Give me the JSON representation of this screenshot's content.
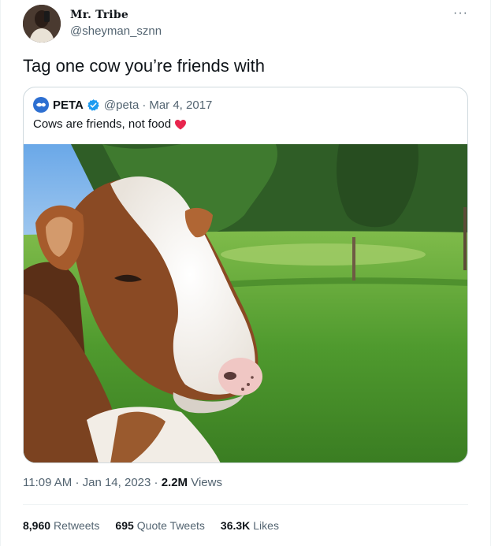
{
  "author": {
    "display_name": "Mr. Tribe",
    "handle": "@sheyman_sznn"
  },
  "more_icon": "more-horizontal-icon",
  "tweet": {
    "text": "Tag one cow you’re friends with"
  },
  "quoted": {
    "name": "PETA",
    "handle": "@peta",
    "separator": "·",
    "date": "Mar 4, 2017",
    "text": "Cows are friends, not food",
    "emoji": "heart-icon",
    "heart_color": "#e8254d",
    "verified_color": "#1d9bf0"
  },
  "meta": {
    "time": "11:09 AM",
    "sep1": "·",
    "date": "Jan 14, 2023",
    "sep2": "·",
    "views_count": "2.2M",
    "views_label": "Views"
  },
  "stats": {
    "retweets_count": "8,960",
    "retweets_label": "Retweets",
    "quotes_count": "695",
    "quotes_label": "Quote Tweets",
    "likes_count": "36.3K",
    "likes_label": "Likes"
  }
}
